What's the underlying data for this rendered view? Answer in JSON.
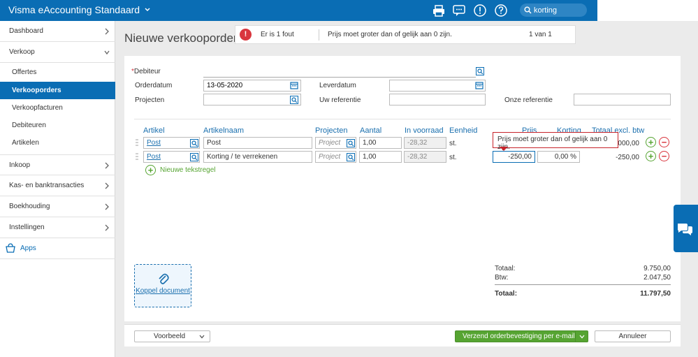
{
  "app": {
    "title": "Visma eAccounting Standaard",
    "accent": "#0a6db4",
    "search": {
      "value": "korting",
      "icon": "search-icon"
    },
    "top_icons": [
      "print-icon",
      "chat-icon",
      "alert-icon",
      "help-icon"
    ]
  },
  "sidebar": {
    "items": [
      {
        "label": "Dashboard",
        "expanded": false
      },
      {
        "label": "Verkoop",
        "expanded": true
      },
      {
        "label": "Inkoop",
        "expanded": false
      },
      {
        "label": "Kas- en banktransacties",
        "expanded": false
      },
      {
        "label": "Boekhouding",
        "expanded": false
      },
      {
        "label": "Instellingen",
        "expanded": false
      }
    ],
    "verkoop_sub": [
      {
        "label": "Offertes"
      },
      {
        "label": "Verkooporders",
        "active": true
      },
      {
        "label": "Verkoopfacturen"
      },
      {
        "label": "Debiteuren"
      },
      {
        "label": "Artikelen"
      }
    ],
    "apps_label": "Apps"
  },
  "page": {
    "title": "Nieuwe verkooporder"
  },
  "error_bar": {
    "count_text": "Er is 1 fout",
    "message": "Prijs moet groter dan of gelijk aan 0 zijn.",
    "pager": "1 van 1",
    "color": "#d9363e"
  },
  "form": {
    "debiteur_label": "Debiteur",
    "debiteur_required": "*",
    "debiteur_value": "",
    "orderdatum_label": "Orderdatum",
    "orderdatum_value": "13-05-2020",
    "leverdatum_label": "Leverdatum",
    "leverdatum_value": "",
    "projecten_label": "Projecten",
    "projecten_value": "",
    "uw_referentie_label": "Uw referentie",
    "uw_referentie_value": "",
    "onze_referentie_label": "Onze referentie",
    "onze_referentie_value": ""
  },
  "lines": {
    "headers": {
      "artikel": "Artikel",
      "artikelnaam": "Artikelnaam",
      "projecten": "Projecten",
      "aantal": "Aantal",
      "in_voorraad": "In voorraad",
      "eenheid": "Eenheid",
      "prijs": "Prijs",
      "korting": "Korting",
      "totaal": "Totaal excl. btw"
    },
    "rows": [
      {
        "artikel": "Post",
        "artikelnaam": "Post",
        "project_placeholder": "Project",
        "aantal": "1,00",
        "in_voorraad": "-28,32",
        "eenheid": "st.",
        "prijs": "",
        "korting": "",
        "totaal": "10.000,00"
      },
      {
        "artikel": "Post",
        "artikelnaam": "Korting / te verrekenen",
        "project_placeholder": "Project",
        "aantal": "1,00",
        "in_voorraad": "-28,32",
        "eenheid": "st.",
        "prijs": "-250,00",
        "korting": "0,00 %",
        "totaal": "-250,00"
      }
    ],
    "tooltip": "Prijs moet groter dan of gelijk aan 0 zijn.",
    "new_line_label": "Nieuwe tekstregel"
  },
  "attachment": {
    "label": "Koppel document"
  },
  "totals": {
    "totaal_label": "Totaal:",
    "totaal_value": "9.750,00",
    "btw_label": "Btw:",
    "btw_value": "2.047,50",
    "grand_label": "Totaal:",
    "grand_value": "11.797,50"
  },
  "footer": {
    "preview_label": "Voorbeeld",
    "send_label": "Verzend orderbevestiging per e-mail",
    "cancel_label": "Annuleer"
  }
}
